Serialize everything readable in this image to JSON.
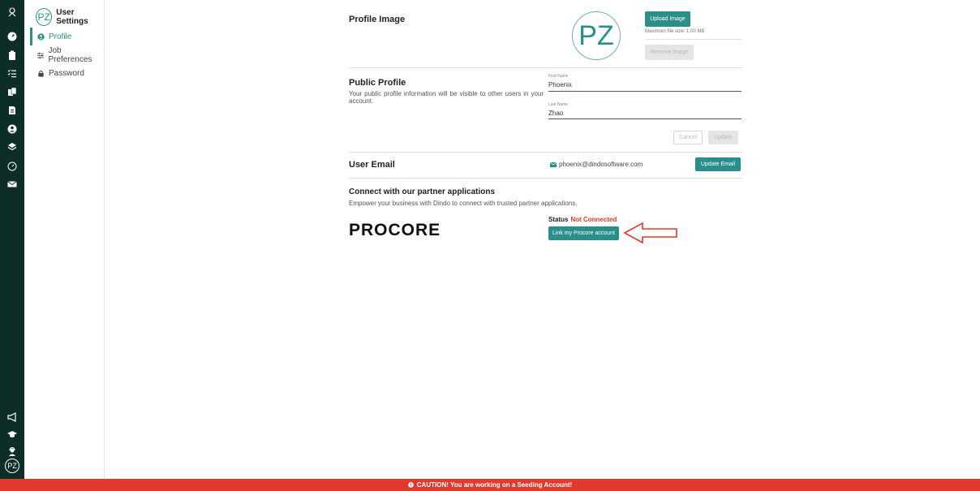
{
  "rail": {
    "avatar_initials": "PZ",
    "icons": [
      "logo-icon",
      "dashboard-icon",
      "clipboard-icon",
      "checklist-icon",
      "documents-icon",
      "file-icon",
      "user-circle-icon",
      "layers-icon",
      "gauge-icon",
      "mail-icon",
      "megaphone-icon",
      "graduation-cap-icon",
      "support-agent-icon"
    ]
  },
  "sidebar": {
    "avatar_initials": "PZ",
    "title": "User Settings",
    "items": [
      {
        "label": "Profile",
        "icon": "user-circle-icon",
        "active": true
      },
      {
        "label": "Job Preferences",
        "icon": "sliders-icon",
        "active": false
      },
      {
        "label": "Password",
        "icon": "lock-icon",
        "active": false
      }
    ]
  },
  "profile_image": {
    "title": "Profile Image",
    "initials": "PZ",
    "upload_label": "Upload Image",
    "max_size_note": "Maximum file size: 1.00 MB",
    "remove_label": "Remove Image"
  },
  "public_profile": {
    "title": "Public Profile",
    "description": "Your public profile information will be visible to other users in your account.",
    "first_name_label": "First Name",
    "first_name_value": "Phoenix",
    "last_name_label": "Last Name",
    "last_name_value": "Zhao",
    "cancel_label": "Cancel",
    "update_label": "Update"
  },
  "user_email": {
    "title": "User Email",
    "email": "phoenix@dindosoftware.com",
    "update_label": "Update Email"
  },
  "partners": {
    "title": "Connect with our partner applications",
    "description": "Empower your business with Dindo to connect with trusted partner applications.",
    "logo_text": "PROCORE",
    "status_label": "Status",
    "status_value": "Not Connected",
    "link_label": "Link my Procore account"
  },
  "caution": {
    "text": "CAUTION! You are working on a Seeding Account!"
  },
  "colors": {
    "rail_bg": "#0c2e26",
    "accent": "#2a8f8a",
    "danger": "#e03a2c",
    "caution_bg": "#e03a2c"
  }
}
